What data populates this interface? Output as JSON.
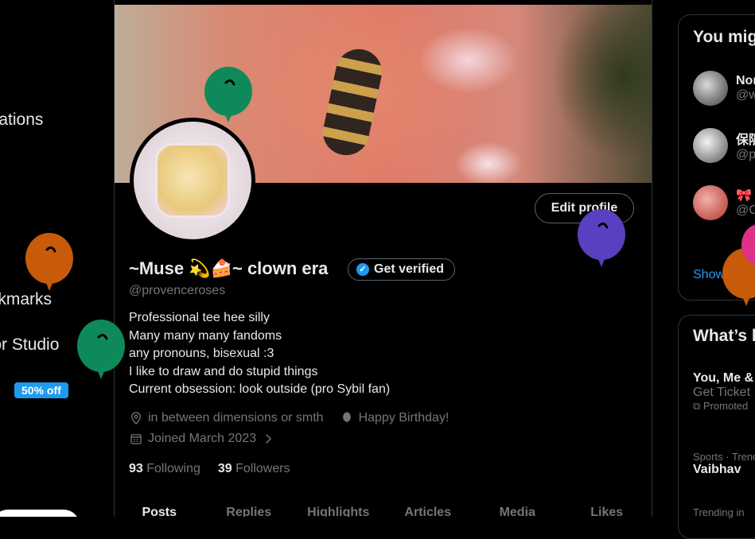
{
  "left_nav": {
    "items": [
      {
        "label": "Notifications"
      },
      {
        "label": "Bookmarks"
      },
      {
        "label": "Creator Studio"
      }
    ],
    "badge": "50% off"
  },
  "profile": {
    "edit_button": "Edit profile",
    "name": "~Muse 💫🍰~ clown era",
    "verified_button": "Get verified",
    "handle": "@provenceroses",
    "bio": [
      "Professional tee hee silly",
      "Many many many fandoms",
      "any pronouns, bisexual :3",
      "I like to draw and do stupid things",
      "Current obsession: look outside (pro Sybil fan)"
    ],
    "location": "in between dimensions or smth",
    "birthday": "Happy Birthday!",
    "joined": "Joined March 2023",
    "following_count": "93",
    "following_label": "Following",
    "followers_count": "39",
    "followers_label": "Followers",
    "tabs": [
      "Posts",
      "Replies",
      "Highlights",
      "Articles",
      "Media",
      "Likes"
    ]
  },
  "sidebar": {
    "who_to_follow_title": "You might like",
    "suggestions": [
      {
        "name": "Nor",
        "handle": "@w"
      },
      {
        "name": "保阪",
        "handle": "@p"
      },
      {
        "name": "🎀",
        "handle": "@C"
      }
    ],
    "show_more": "Show more",
    "whats_happening_title": "What’s happening",
    "trends": [
      {
        "title": "You, Me &",
        "sub": "Get Ticket",
        "meta": "Promoted"
      },
      {
        "meta": "Sports · Trending",
        "title": "Vaibhav"
      },
      {
        "meta": "Trending in"
      }
    ]
  },
  "colors": {
    "accent": "#1d9bf0",
    "background": "#000000",
    "balloon_orange": "#c75b0a",
    "balloon_green": "#0e8a5a",
    "balloon_purple": "#5a3fc0",
    "balloon_pink": "#e0318a"
  }
}
